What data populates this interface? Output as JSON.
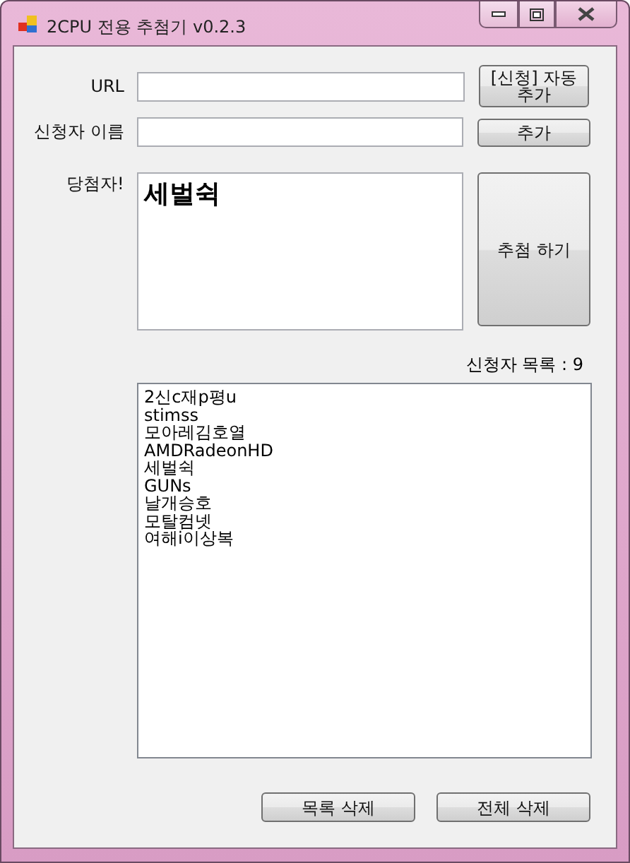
{
  "window": {
    "title": "2CPU 전용 추첨기 v0.2.3"
  },
  "url": {
    "label": "URL"
  },
  "auto_add_button": {
    "label": "[신청] 자동 추가"
  },
  "applicant_name": {
    "label": "신청자 이름"
  },
  "add_button": {
    "label": "추가"
  },
  "winner": {
    "label": "당첨자!",
    "value": "세벌쉭"
  },
  "draw_button": {
    "label": "추첨 하기"
  },
  "applicant_count": "신청자 목록 : 9",
  "applicants": [
    "2신c재p평u",
    "stimss",
    "모아레김호열",
    "AMDRadeonHD",
    "세벌쉭",
    "GUNs",
    "날개승호",
    "모탈컴넷",
    "여해i이상복"
  ],
  "buttons": [
    "목록 삭제",
    "전체 삭제"
  ]
}
